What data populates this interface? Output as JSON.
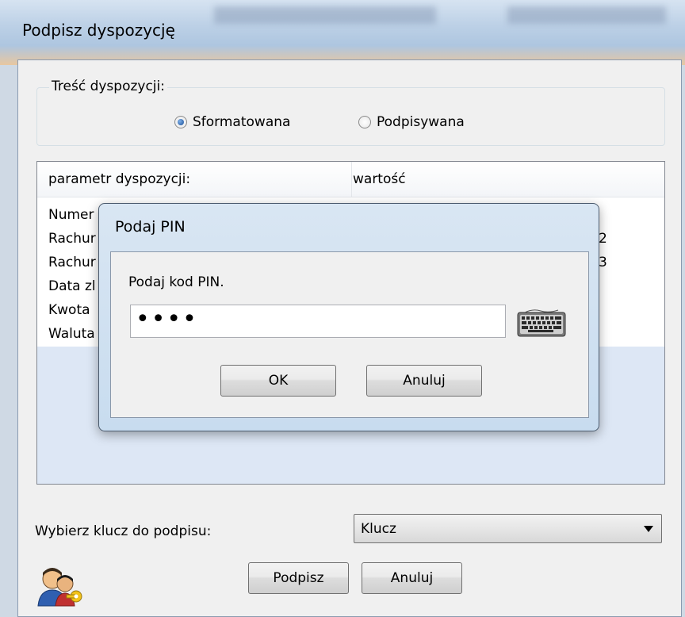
{
  "window": {
    "title": "Podpisz dyspozycję"
  },
  "content_group": {
    "legend": "Treść dyspozycji:",
    "options": [
      {
        "label": "Sformatowana",
        "checked": true
      },
      {
        "label": "Podpisywana",
        "checked": false
      }
    ]
  },
  "params_list": {
    "columns": [
      "parametr dyspozycji:",
      "wartość"
    ],
    "rows": [
      {
        "name": "Numer",
        "value": "",
        "value_suffix": ""
      },
      {
        "name": "Rachur",
        "value": "",
        "value_suffix": "2"
      },
      {
        "name": "Rachur",
        "value": "",
        "value_suffix": "3"
      },
      {
        "name": "Data zl",
        "value": "",
        "value_suffix": ""
      },
      {
        "name": "Kwota",
        "value": "",
        "value_suffix": ""
      },
      {
        "name": "Waluta",
        "value": "",
        "value_suffix": ""
      }
    ]
  },
  "pin_dialog": {
    "title": "Podaj PIN",
    "prompt": "Podaj kod PIN.",
    "pin_value": "••••",
    "ok_label": "OK",
    "cancel_label": "Anuluj",
    "keyboard_icon": "keyboard-icon"
  },
  "signature": {
    "label": "Wybierz klucz do podpisu:",
    "selected_key": "Klucz",
    "sign_label": "Podpisz",
    "cancel_label": "Anuluj",
    "user_icon": "users-key-icon"
  }
}
